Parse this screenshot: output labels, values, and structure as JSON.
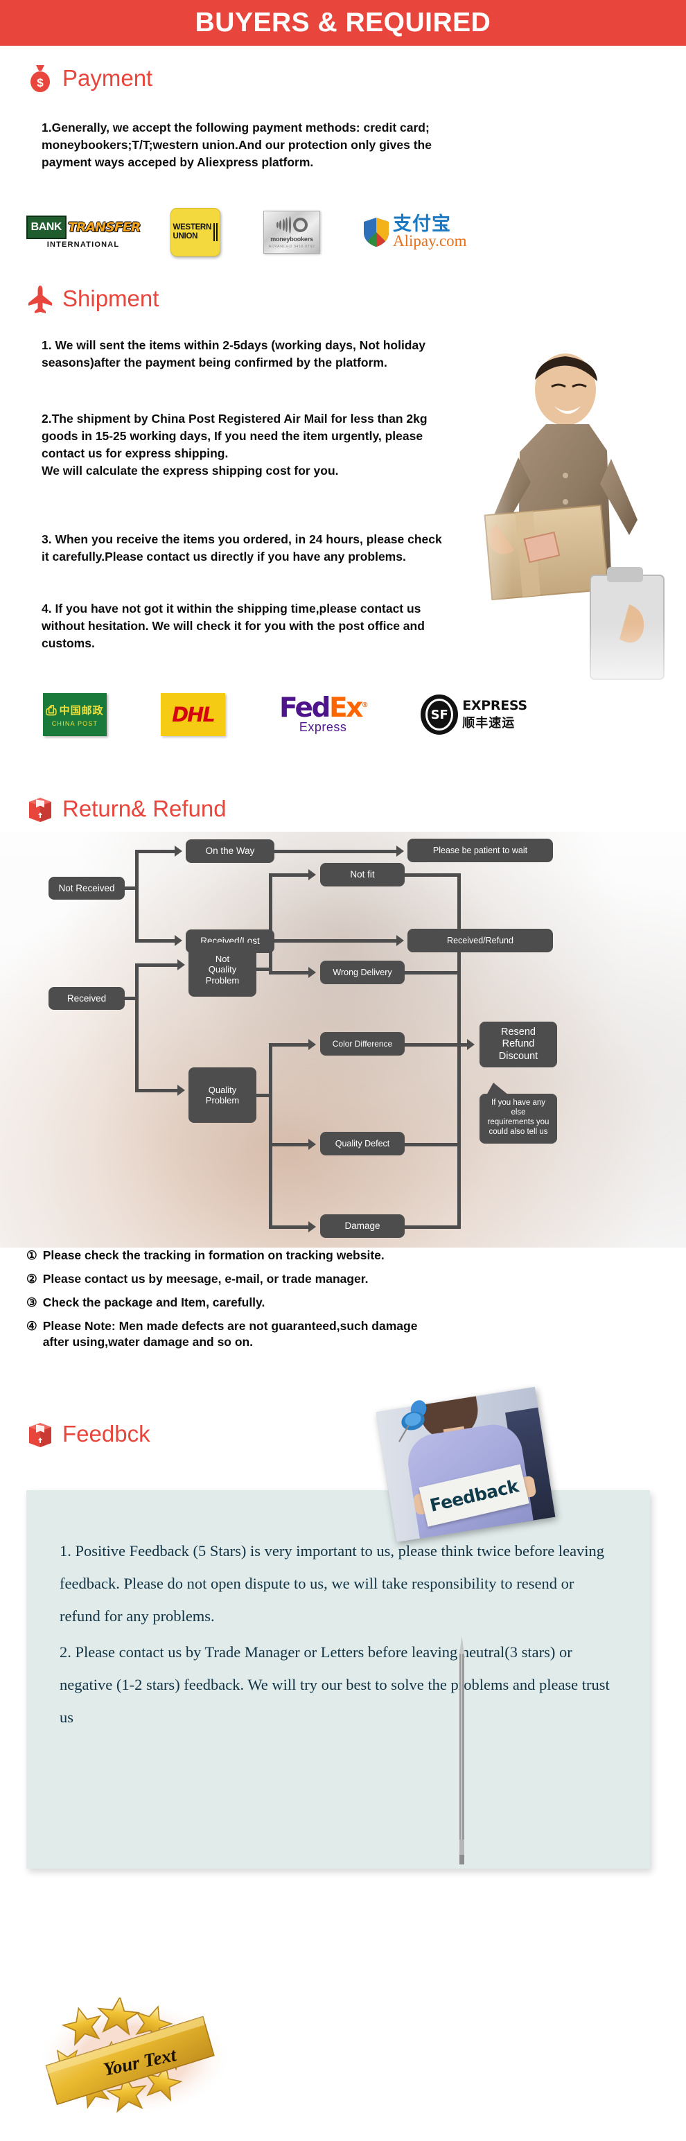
{
  "header": {
    "title": "BUYERS & REQUIRED"
  },
  "sections": {
    "payment": {
      "heading": "Payment",
      "icon": "money-bag-icon",
      "body": "1.Generally, we accept the following payment methods: credit card;\nmoneybookers;T/T;western union.And our protection only gives the\npayment ways acceped by Aliexpress platform.",
      "logos": [
        {
          "name": "bank-transfer",
          "primary": "BANK",
          "secondary": "TRANSFER",
          "tertiary": "INTERNATIONAL"
        },
        {
          "name": "western-union",
          "line1": "WESTERN",
          "line2": "UNION"
        },
        {
          "name": "moneybookers",
          "word": "moneybookers",
          "tiny": "ADVANCED   3416 0792"
        },
        {
          "name": "alipay",
          "cn": "支付宝",
          "com": "Alipay.com"
        }
      ]
    },
    "shipment": {
      "heading": "Shipment",
      "icon": "airplane-icon",
      "body1": "1. We will sent the items within 2-5days (working days, Not holiday\nseasons)after the payment being confirmed by the platform.",
      "body2": "2.The shipment by China Post Registered Air Mail for less than  2kg\ngoods in 15-25 working days, If  you need the item urgently, please\ncontact us for express shipping.\nWe will calculate the express shipping cost for you.",
      "body3": "3. When you receive the items you ordered, in 24 hours, please check\n it carefully.Please contact us directly if you have any problems.",
      "body4": "4. If you have not got it within the shipping time,please contact us\nwithout hesitation. We will check it for you with the post office and\ncustoms.",
      "logos": [
        {
          "name": "china-post",
          "cn": "中国邮政",
          "en": "CHINA POST"
        },
        {
          "name": "dhl",
          "word": "DHL"
        },
        {
          "name": "fedex",
          "fed": "Fed",
          "ex": "Ex",
          "sub": "Express"
        },
        {
          "name": "sf-express",
          "mark": "SF",
          "en": "EXPRESS",
          "cn": "顺丰速运"
        }
      ]
    },
    "return_refund": {
      "heading": "Return& Refund",
      "icon": "package-box-icon",
      "flow": {
        "not_received": "Not Received",
        "on_the_way": "On the Way",
        "please_wait": "Please be patient to wait",
        "received_lost": "Received/Lost",
        "received_refund": "Received/Refund",
        "received": "Received",
        "not_quality_problem": "Not\nQuality\nProblem",
        "quality_problem": "Quality\nProblem",
        "not_fit": "Not fit",
        "wrong_delivery": "Wrong Delivery",
        "color_difference": "Color Difference",
        "quality_defect": "Quality Defect",
        "damage": "Damage",
        "resend_refund_discount": "Resend\nRefund\nDiscount",
        "callout": "If you have any else\nrequirements you\ncould also tell us"
      },
      "notes": [
        {
          "glyph": "①",
          "text": "Please check the tracking in formation on tracking website."
        },
        {
          "glyph": "②",
          "text": "Please contact us by meesage, e-mail, or trade manager."
        },
        {
          "glyph": "③",
          "text": "Check the package and Item, carefully."
        },
        {
          "glyph": "④",
          "text": "Please Note: Men made defects  are not guaranteed,such damage\n     after using,water damage and so on."
        }
      ]
    },
    "feedback": {
      "heading": "Feedbck",
      "icon": "package-box-icon",
      "photo_sign_text": "Feedback",
      "paragraph1": "1. Positive Feedback (5 Stars) is very important to us, please think twice before leaving feedback. Please do not open dispute to us,   we will take responsibility to resend or refund for any problems.",
      "paragraph2": "2. Please contact us by Trade Manager or Letters before leaving neutral(3 stars) or negative (1-2 stars) feedback. We will try our best to solve the problems and please trust us",
      "ribbon_text": "Your Text"
    }
  },
  "colors": {
    "accent_red": "#e8453c",
    "node_gray": "#4d4d4d",
    "feedback_card": "#e0ebea",
    "feedback_text": "#123344",
    "gold": "#e8b32a"
  }
}
